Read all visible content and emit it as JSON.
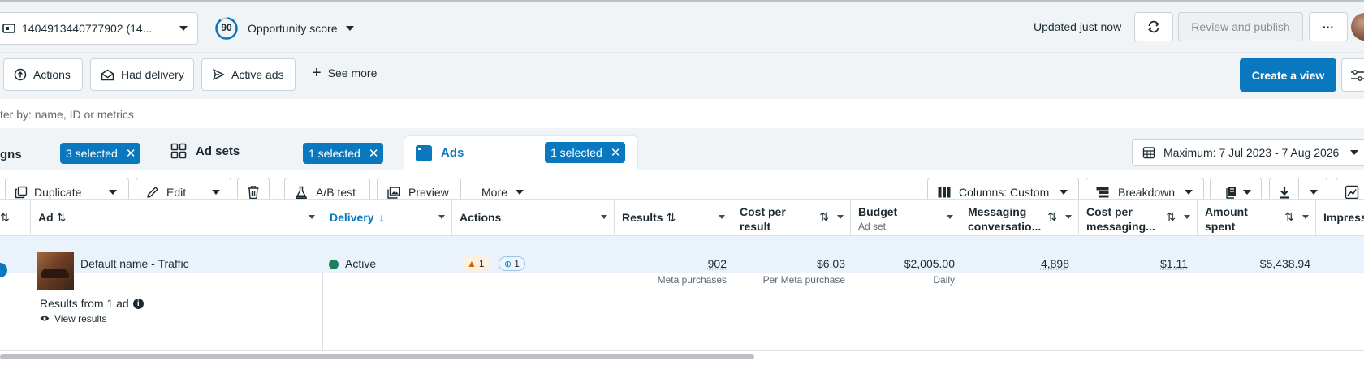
{
  "header": {
    "account_label": "1404913440777902 (14...",
    "opportunity_score": "90",
    "opportunity_label": "Opportunity score",
    "updated_text": "Updated just now",
    "review_publish_label": "Review and publish",
    "more_label": "···"
  },
  "filters": {
    "actions_label": "Actions",
    "had_delivery_label": "Had delivery",
    "active_ads_label": "Active ads",
    "see_more_label": "See more",
    "create_view_label": "Create a view",
    "search_placeholder": "ter by: name, ID or metrics"
  },
  "tabs": {
    "campaigns_label": "gns",
    "campaigns_selected": "3 selected",
    "adsets_label": "Ad sets",
    "adsets_selected": "1 selected",
    "ads_label": "Ads",
    "ads_selected": "1 selected",
    "date_range": "Maximum: 7 Jul 2023 - 7 Aug 2026"
  },
  "toolbar": {
    "duplicate_label": "Duplicate",
    "edit_label": "Edit",
    "ab_test_label": "A/B test",
    "preview_label": "Preview",
    "more_label": "More",
    "columns_label": "Columns: Custom",
    "breakdown_label": "Breakdown"
  },
  "table": {
    "headers": {
      "ad": "Ad",
      "delivery": "Delivery",
      "actions": "Actions",
      "results": "Results",
      "cost_per_result_1": "Cost per",
      "cost_per_result_2": "result",
      "budget": "Budget",
      "budget_sub": "Ad set",
      "messaging_1": "Messaging",
      "messaging_2": "conversatio...",
      "cost_messaging_1": "Cost per",
      "cost_messaging_2": "messaging...",
      "amount_1": "Amount",
      "amount_2": "spent",
      "impressions": "Impress"
    },
    "row": {
      "ad_name": "Default name - Traffic",
      "delivery": "Active",
      "warning_count": "1",
      "info_count": "1",
      "results": "902",
      "results_sub": "Meta purchases",
      "cost_per_result": "$6.03",
      "cost_per_result_sub": "Per Meta purchase",
      "budget": "$2,005.00",
      "budget_sub": "Daily",
      "messaging": "4,898",
      "cost_messaging": "$1.11",
      "amount_spent": "$5,438.94"
    },
    "summary": {
      "results_from": "Results from 1 ad",
      "view_results": "View results"
    }
  },
  "colors": {
    "accent": "#0a78be",
    "active_dot": "#1e7d5a",
    "warning": "#f0a43b"
  }
}
